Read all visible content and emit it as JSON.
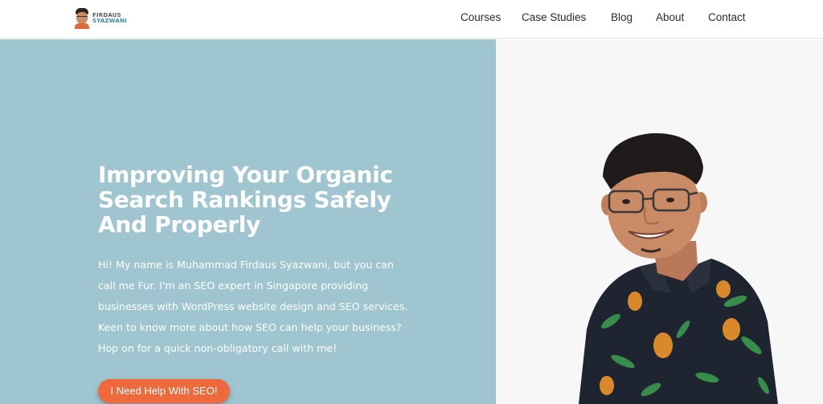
{
  "brand": {
    "logo_line1": "FIRDAUS",
    "logo_line2": "SYAZWANI"
  },
  "nav": {
    "items": [
      {
        "label": "Courses"
      },
      {
        "label": "Case Studies"
      },
      {
        "label": "Blog"
      },
      {
        "label": "About"
      },
      {
        "label": "Contact"
      }
    ]
  },
  "hero": {
    "headline_lines": [
      "Improving Your Organic",
      "Search Rankings Safely",
      "And Properly"
    ],
    "intro_lines": [
      "Hi! My name is Muhammad Firdaus Syazwani, but you can",
      "call me Fur. I'm an SEO expert in Singapore providing",
      "businesses with WordPress website design and SEO services.",
      "Keen to know more about how SEO can help your business?",
      "Hop on for a quick non-obligatory call with me!"
    ],
    "cta_label": "I Need Help With SEO!"
  },
  "colors": {
    "hero_background": "#9ec5d0",
    "cta_background": "#ee6a3d",
    "right_panel": "#f7f7f7"
  },
  "icons": {
    "logo": "person-avatar-icon",
    "portrait": "man-portrait-photo"
  }
}
